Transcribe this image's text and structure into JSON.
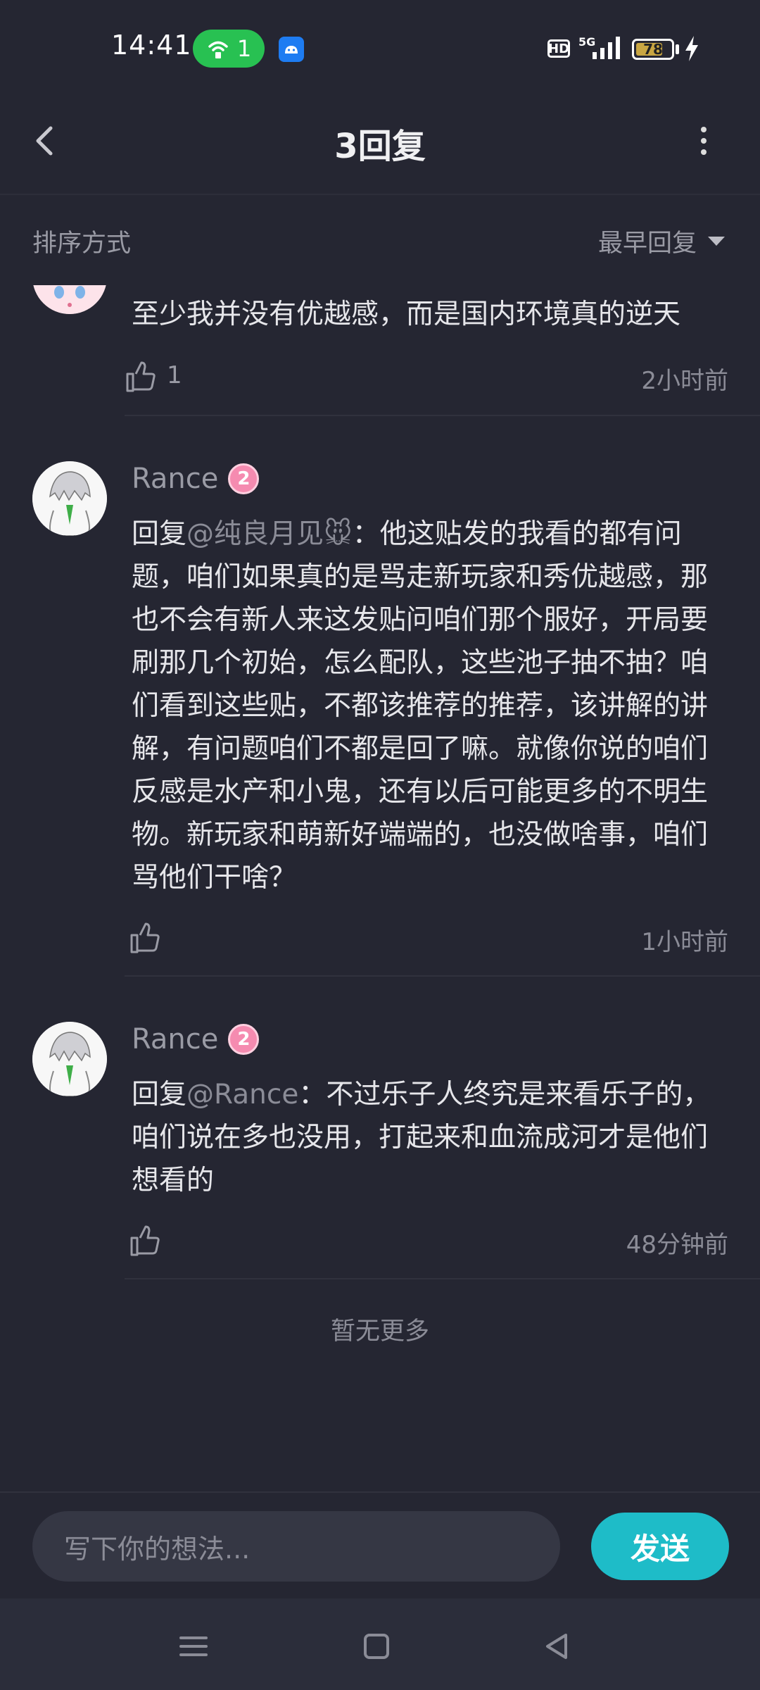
{
  "status_bar": {
    "time": "14:41",
    "hotspot_count": "1",
    "hd_label": "HD",
    "network_label": "5G",
    "battery_level": "78",
    "battery_fraction": 0.78
  },
  "header": {
    "title": "3回复"
  },
  "sort": {
    "label": "排序方式",
    "selected": "最早回复"
  },
  "comments": [
    {
      "text": "至少我并没有优越感，而是国内环境真的逆天",
      "likes": "1",
      "time": "2小时前"
    },
    {
      "username": "Rance",
      "level": "2",
      "reply_prefix": "回复",
      "mention": "@纯良月见🐭",
      "separator": "：",
      "text": "他这贴发的我看的都有问题，咱们如果真的是骂走新玩家和秀优越感，那也不会有新人来这发贴问咱们那个服好，开局要刷那几个初始，怎么配队，这些池子抽不抽？咱们看到这些贴，不都该推荐的推荐，该讲解的讲解，有问题咱们不都是回了嘛。就像你说的咱们反感是水产和小鬼，还有以后可能更多的不明生物。新玩家和萌新好端端的，也没做啥事，咱们骂他们干啥？",
      "time": "1小时前"
    },
    {
      "username": "Rance",
      "level": "2",
      "reply_prefix": "回复",
      "mention": "@Rance",
      "separator": "：",
      "text": "不过乐子人终究是来看乐子的，咱们说在多也没用，打起来和血流成河才是他们想看的",
      "time": "48分钟前"
    }
  ],
  "no_more_text": "暂无更多",
  "compose": {
    "placeholder": "写下你的想法...",
    "send_label": "发送"
  },
  "colors": {
    "background": "#252632",
    "accent": "#1ebcc8",
    "hotspot": "#28c152",
    "level_badge": "#f58bb0"
  },
  "icons": [
    "back-arrow-icon",
    "more-vert-icon",
    "caret-down-icon",
    "thumb-up-icon",
    "menu-icon",
    "home-square-icon",
    "back-triangle-icon"
  ]
}
